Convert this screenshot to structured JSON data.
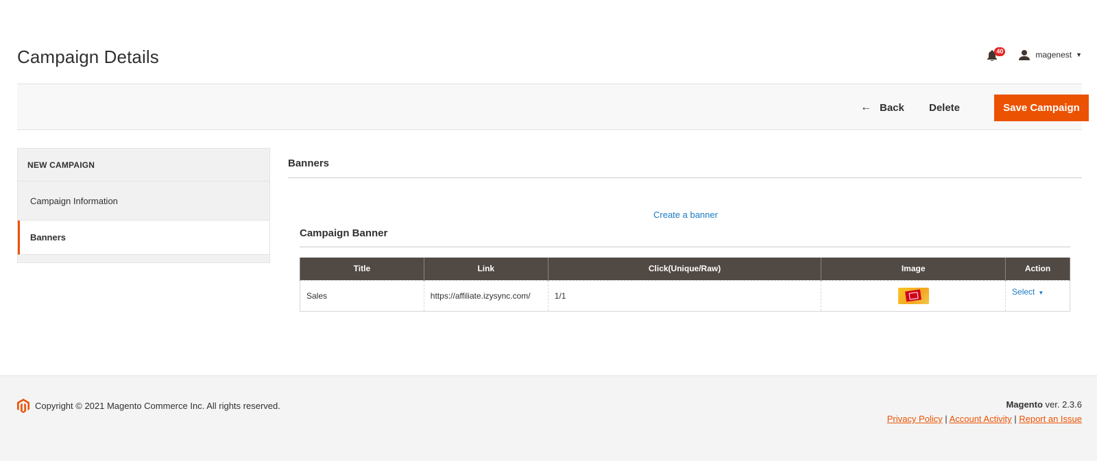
{
  "header": {
    "title": "Campaign Details",
    "notifications_count": "40",
    "username": "magenest"
  },
  "actions": {
    "back_label": "Back",
    "delete_label": "Delete",
    "save_label": "Save Campaign"
  },
  "sidebar": {
    "title": "NEW CAMPAIGN",
    "items": [
      {
        "label": "Campaign Information"
      },
      {
        "label": "Banners"
      }
    ]
  },
  "main": {
    "section_title": "Banners",
    "create_link": "Create a banner",
    "subsection_title": "Campaign Banner",
    "table": {
      "columns": [
        "Title",
        "Link",
        "Click(Unique/Raw)",
        "Image",
        "Action"
      ],
      "rows": [
        {
          "title": "Sales",
          "link": "https://affiliate.izysync.com/",
          "clicks": "1/1",
          "action": "Select"
        }
      ]
    }
  },
  "footer": {
    "copyright": "Copyright © 2021 Magento Commerce Inc. All rights reserved.",
    "brand": "Magento",
    "version": " ver. 2.3.6",
    "links": [
      "Privacy Policy",
      "Account Activity",
      "Report an Issue"
    ]
  },
  "colors": {
    "accent": "#eb5202",
    "link": "#1979c3",
    "table_header": "#514943"
  }
}
